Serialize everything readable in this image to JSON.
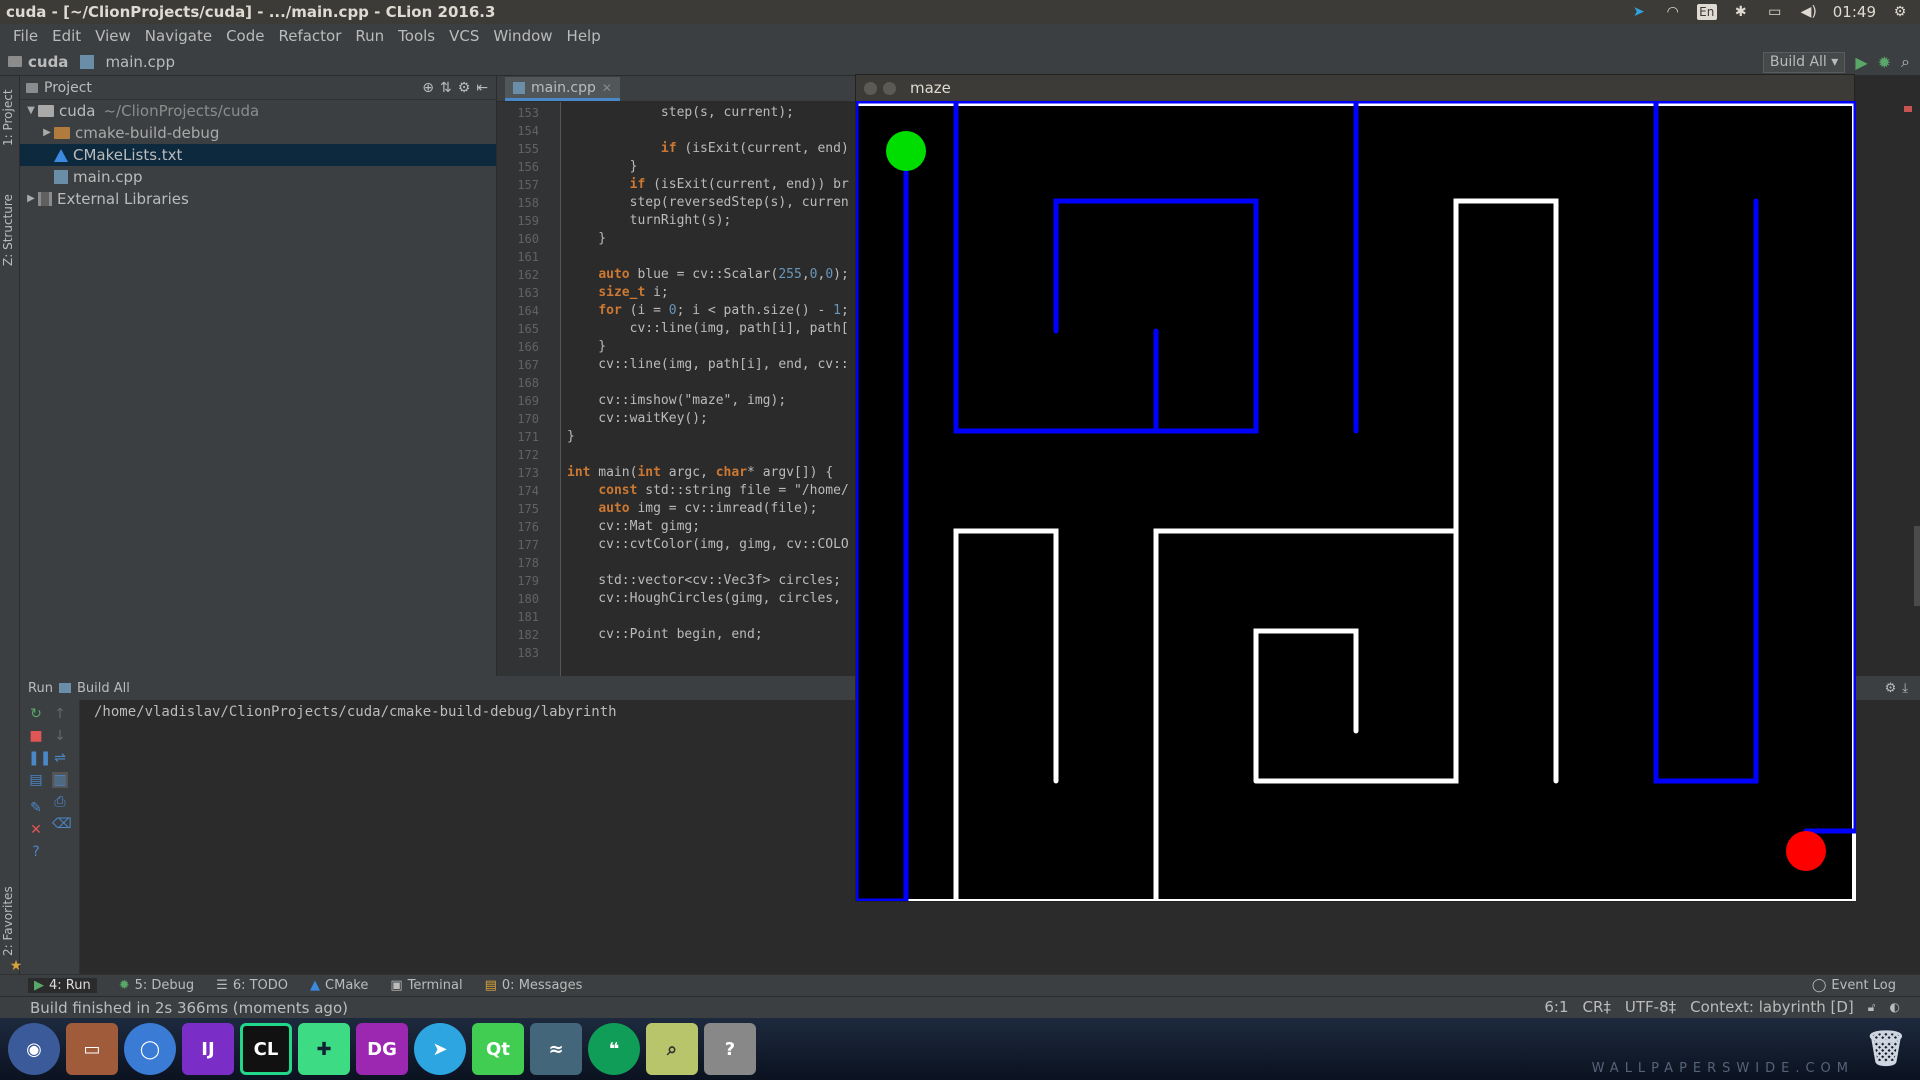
{
  "window": {
    "title": "cuda - [~/ClionProjects/cuda] - .../main.cpp - CLion 2016.3"
  },
  "tray": {
    "lang": "En",
    "time": "01:49"
  },
  "menu": [
    "File",
    "Edit",
    "View",
    "Navigate",
    "Code",
    "Refactor",
    "Run",
    "Tools",
    "VCS",
    "Window",
    "Help"
  ],
  "nav": {
    "project": "cuda",
    "file": "main.cpp",
    "build_config": "Build All"
  },
  "left_tabs": {
    "project": "1: Project",
    "structure": "Z: Structure",
    "favorites": "2: Favorites"
  },
  "project_panel": {
    "title": "Project",
    "tree": [
      {
        "label": "cuda",
        "hint": "~/ClionProjects/cuda"
      },
      {
        "label": "cmake-build-debug"
      },
      {
        "label": "CMakeLists.txt"
      },
      {
        "label": "main.cpp"
      },
      {
        "label": "External Libraries"
      }
    ]
  },
  "editor": {
    "tab": "main.cpp",
    "line_numbers": [
      "153",
      "154",
      "155",
      "156",
      "157",
      "158",
      "159",
      "160",
      "161",
      "162",
      "163",
      "164",
      "165",
      "166",
      "167",
      "168",
      "169",
      "170",
      "171",
      "172",
      "173",
      "174",
      "175",
      "176",
      "177",
      "178",
      "179",
      "180",
      "181",
      "182",
      "183"
    ],
    "lines": [
      "            step(s, current);",
      "",
      "            if (isExit(current, end)",
      "        }",
      "        if (isExit(current, end)) br",
      "        step(reversedStep(s), curren",
      "        turnRight(s);",
      "    }",
      "",
      "    auto blue = cv::Scalar(255,0,0);",
      "    size_t i;",
      "    for (i = 0; i < path.size() - 1;",
      "        cv::line(img, path[i], path[",
      "    }",
      "    cv::line(img, path[i], end, cv::",
      "",
      "    cv::imshow(\"maze\", img);",
      "    cv::waitKey();",
      "}",
      "",
      "int main(int argc, char* argv[]) {",
      "    const std::string file = \"/home/",
      "    auto img = cv::imread(file);",
      "    cv::Mat gimg;",
      "    cv::cvtColor(img, gimg, cv::COLO",
      "",
      "    std::vector<cv::Vec3f> circles;",
      "    cv::HoughCircles(gimg, circles,",
      "",
      "    cv::Point begin, end;",
      ""
    ]
  },
  "run_panel": {
    "title": "Run",
    "config": "Build All",
    "output": "/home/vladislav/ClionProjects/cuda/cmake-build-debug/labyrinth"
  },
  "bottom_tools": [
    "4: Run",
    "5: Debug",
    "6: TODO",
    "CMake",
    "Terminal",
    "0: Messages"
  ],
  "event_log": "Event Log",
  "status": {
    "message": "Build finished in 2s 366ms (moments ago)",
    "position": "6:1",
    "line_sep": "CR‡",
    "encoding": "UTF-8‡",
    "context": "Context: labyrinth [D]"
  },
  "maze_window": {
    "title": "maze"
  },
  "dock": [
    "Chromium",
    "Files",
    "Chrome",
    "IJ",
    "CL",
    "Android Studio",
    "DG",
    "Telegram",
    "Qt",
    "MySQL Workbench",
    "Hangouts",
    "Viewer",
    "Unknown"
  ],
  "wallpaper_text": "WALLPAPERSWIDE.COM",
  "colors": {
    "path": "#0000ff",
    "start": "#00dd00",
    "end": "#ff0000",
    "walls": "#ffffff"
  }
}
